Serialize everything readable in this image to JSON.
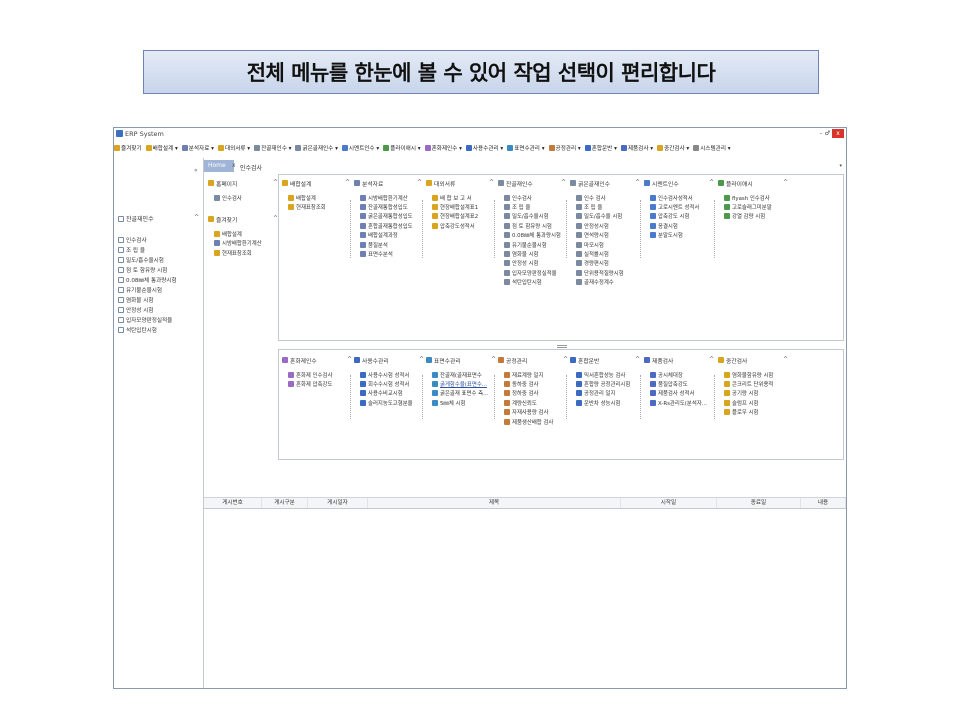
{
  "banner": {
    "text": "전체 메뉴를 한눈에 볼 수 있어 작업 선택이 편리합니다"
  },
  "window": {
    "title": "ERP System",
    "controls": {
      "minimize": "-",
      "restore": "♂",
      "close": "x"
    }
  },
  "menubar": [
    {
      "label": "즐겨찾기",
      "color": "#d9a520"
    },
    {
      "label": "배합설계 ▾",
      "color": "#d9a520"
    },
    {
      "label": "분석자료 ▾",
      "color": "#6d7fb3"
    },
    {
      "label": "대외서류 ▾",
      "color": "#d9a520"
    },
    {
      "label": "잔골재인수 ▾",
      "color": "#7a8aa0"
    },
    {
      "label": "굵은골재인수 ▾",
      "color": "#7a8aa0"
    },
    {
      "label": "시멘트인수 ▾",
      "color": "#4a7acc"
    },
    {
      "label": "플라이애시 ▾",
      "color": "#4a9a4a"
    },
    {
      "label": "혼화제인수 ▾",
      "color": "#9a6ac4"
    },
    {
      "label": "사용수관리 ▾",
      "color": "#3a6ac4"
    },
    {
      "label": "표면수관리 ▾",
      "color": "#3a8ac4"
    },
    {
      "label": "공정관리 ▾",
      "color": "#c47a3a"
    },
    {
      "label": "혼합운반 ▾",
      "color": "#3a6ac4"
    },
    {
      "label": "제품검사 ▾",
      "color": "#4a6ac4"
    },
    {
      "label": "중간검사 ▾",
      "color": "#d9a520"
    },
    {
      "label": "시스템관리 ▾",
      "color": "#888888"
    }
  ],
  "tabs": {
    "home": "Home",
    "close": "x",
    "current": "인수검사",
    "arrow": "▾"
  },
  "sidebar": {
    "collapse": "«",
    "header": "잔골재인수",
    "caret": "^",
    "items": [
      "인수검사",
      "조 립 율",
      "밀도/흡수율시험",
      "점 토 함유량 시험",
      "0.08㎜체 통과량시험",
      "유기불순물시험",
      "염화물 시험",
      "안정성 시험",
      "입자모양판정실적율",
      "석탄입탄시험"
    ]
  },
  "top_columns": [
    {
      "header": "홈페이지",
      "color": "#d9a520",
      "items": [
        {
          "label": "인수검사",
          "color": "#7a8aa0"
        }
      ],
      "sub_header": "즐겨찾기",
      "sub_items": [
        {
          "label": "배합설계",
          "color": "#d9a520"
        },
        {
          "label": "시방배합환기계산",
          "color": "#6d7fb3"
        },
        {
          "label": "현재표창조회",
          "color": "#d9a520"
        }
      ]
    },
    {
      "header": "배합설계",
      "color": "#d9a520",
      "items": [
        {
          "label": "배합설계",
          "color": "#d9a520"
        },
        {
          "label": "현재표창조회",
          "color": "#d9a520"
        }
      ]
    },
    {
      "header": "분석자료",
      "color": "#6d7fb3",
      "items": [
        {
          "label": "시방배합환기계산",
          "color": "#6d7fb3"
        },
        {
          "label": "잔골재통합성입도",
          "color": "#6d7fb3"
        },
        {
          "label": "굵은골재통합성입도",
          "color": "#6d7fb3"
        },
        {
          "label": "혼합골재통합성입도",
          "color": "#6d7fb3"
        },
        {
          "label": "배합설계과정",
          "color": "#6d7fb3"
        },
        {
          "label": "품질분석",
          "color": "#6d7fb3"
        },
        {
          "label": "표면수분석",
          "color": "#6d7fb3"
        }
      ]
    },
    {
      "header": "대외서류",
      "color": "#d9a520",
      "items": [
        {
          "label": "배 합 보 고 서",
          "color": "#d9a520"
        },
        {
          "label": "현장배합설계표1",
          "color": "#d9a520"
        },
        {
          "label": "현장배합설계표2",
          "color": "#d9a520"
        },
        {
          "label": "압축강도성적서",
          "color": "#d9a520"
        }
      ]
    },
    {
      "header": "잔골재인수",
      "color": "#7a8aa0",
      "items": [
        {
          "label": "인수검사",
          "color": "#7a8aa0"
        },
        {
          "label": "조 립 율",
          "color": "#7a8aa0"
        },
        {
          "label": "밀도/흡수율시험",
          "color": "#7a8aa0"
        },
        {
          "label": "점 토 함유량 시험",
          "color": "#7a8aa0"
        },
        {
          "label": "0.08㎜체 통과량시험",
          "color": "#7a8aa0"
        },
        {
          "label": "유기불순물시험",
          "color": "#7a8aa0"
        },
        {
          "label": "염화물 시험",
          "color": "#7a8aa0"
        },
        {
          "label": "안정성 시험",
          "color": "#7a8aa0"
        },
        {
          "label": "입자모양판정실적율",
          "color": "#7a8aa0"
        },
        {
          "label": "석탄입탄시험",
          "color": "#7a8aa0"
        }
      ]
    },
    {
      "header": "굵은골재인수",
      "color": "#7a8aa0",
      "items": [
        {
          "label": "인수 검사",
          "color": "#7a8aa0"
        },
        {
          "label": "조 립 율",
          "color": "#7a8aa0"
        },
        {
          "label": "밀도/흡수율 시험",
          "color": "#7a8aa0"
        },
        {
          "label": "안정성시험",
          "color": "#7a8aa0"
        },
        {
          "label": "연석량시험",
          "color": "#7a8aa0"
        },
        {
          "label": "마모시험",
          "color": "#7a8aa0"
        },
        {
          "label": "실적률시험",
          "color": "#7a8aa0"
        },
        {
          "label": "경량편시험",
          "color": "#7a8aa0"
        },
        {
          "label": "단위용적질량시험",
          "color": "#7a8aa0"
        },
        {
          "label": "골재수정계수",
          "color": "#7a8aa0"
        }
      ]
    },
    {
      "header": "시멘트인수",
      "color": "#4a7acc",
      "items": [
        {
          "label": "인수검사성적서",
          "color": "#4a7acc"
        },
        {
          "label": "고로시멘트 성적서",
          "color": "#4a7acc"
        },
        {
          "label": "압축강도 시험",
          "color": "#4a7acc"
        },
        {
          "label": "응결시험",
          "color": "#4a7acc"
        },
        {
          "label": "분말도시험",
          "color": "#4a7acc"
        }
      ]
    },
    {
      "header": "플라이애시",
      "color": "#4a9a4a",
      "items": [
        {
          "label": "flyash 인수검사",
          "color": "#4a9a4a"
        },
        {
          "label": "고로슬래그미분말",
          "color": "#4a9a4a"
        },
        {
          "label": "강열 감량 시험",
          "color": "#4a9a4a"
        }
      ]
    }
  ],
  "bottom_columns": [
    {
      "header": "혼화제인수",
      "color": "#9a6ac4",
      "items": [
        {
          "label": "혼화제 인수검사",
          "color": "#9a6ac4"
        },
        {
          "label": "혼화제 압축강도",
          "color": "#9a6ac4"
        }
      ]
    },
    {
      "header": "사용수관리",
      "color": "#3a6ac4",
      "items": [
        {
          "label": "사용수시험 성적서",
          "color": "#3a6ac4"
        },
        {
          "label": "회수수시험 성적서",
          "color": "#3a6ac4"
        },
        {
          "label": "사용수비교시험",
          "color": "#3a6ac4"
        },
        {
          "label": "슬러지농도고형분율",
          "color": "#3a6ac4"
        }
      ]
    },
    {
      "header": "표면수관리",
      "color": "#3a8ac4",
      "items": [
        {
          "label": "잔골재(골재표면수",
          "color": "#3a8ac4"
        },
        {
          "label": "굵게함수율(표면수...",
          "color": "#3a8ac4",
          "link": true
        },
        {
          "label": "굵은골재 표면수 측...",
          "color": "#3a8ac4"
        },
        {
          "label": "5㎜체 시험",
          "color": "#3a8ac4"
        }
      ]
    },
    {
      "header": "공정관리",
      "color": "#c47a3a",
      "items": [
        {
          "label": "재료계량 일지",
          "color": "#c47a3a"
        },
        {
          "label": "동하중 검사",
          "color": "#c47a3a"
        },
        {
          "label": "정하중 검사",
          "color": "#c47a3a"
        },
        {
          "label": "계량신뢰도",
          "color": "#c47a3a"
        },
        {
          "label": "자재사용량 검사",
          "color": "#c47a3a"
        },
        {
          "label": "제품생산배합 검사",
          "color": "#c47a3a"
        }
      ]
    },
    {
      "header": "혼합운반",
      "color": "#3a6ac4",
      "items": [
        {
          "label": "믹서혼합성능 검사",
          "color": "#3a6ac4"
        },
        {
          "label": "혼합량 공정관리시험",
          "color": "#3a6ac4"
        },
        {
          "label": "공정관리 일지",
          "color": "#3a6ac4"
        },
        {
          "label": "운반차 성능시험",
          "color": "#3a6ac4"
        }
      ]
    },
    {
      "header": "제품검사",
      "color": "#4a6ac4",
      "items": [
        {
          "label": "공시체대장",
          "color": "#4a6ac4"
        },
        {
          "label": "품질압축강도",
          "color": "#4a6ac4"
        },
        {
          "label": "제품검사 성적서",
          "color": "#4a6ac4"
        },
        {
          "label": "X-Rs관리도(분석자...",
          "color": "#4a6ac4"
        }
      ]
    },
    {
      "header": "중간검사",
      "color": "#d9a520",
      "items": [
        {
          "label": "염화물함유량 시험",
          "color": "#d9a520"
        },
        {
          "label": "콘크리트 단위용적",
          "color": "#d9a520"
        },
        {
          "label": "공기량 시험",
          "color": "#d9a520"
        },
        {
          "label": "슬럼프 시험",
          "color": "#d9a520"
        },
        {
          "label": "플로우 시험",
          "color": "#d9a520"
        }
      ]
    }
  ],
  "splitter": "—",
  "grid": {
    "columns": [
      "게시번호",
      "게시구분",
      "게시일자",
      "제목",
      "시작일",
      "종료일",
      "내용"
    ]
  }
}
